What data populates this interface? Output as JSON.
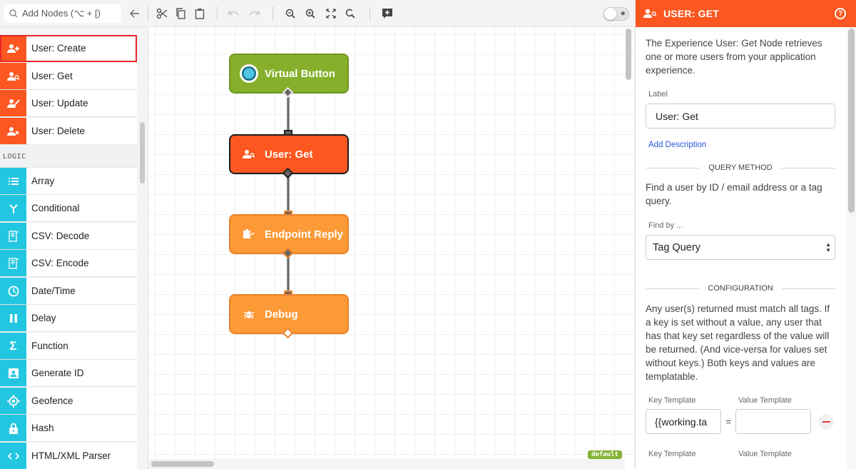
{
  "toolbar": {
    "search_placeholder": "Add Nodes (⌥ + [)",
    "icons": [
      "search-icon",
      "back-arrow-icon",
      "cut-icon",
      "copy-icon",
      "paste-icon",
      "undo-icon",
      "redo-icon",
      "zoom-out-icon",
      "zoom-in-icon",
      "fit-screen-icon",
      "reset-zoom-icon",
      "add-comment-icon"
    ],
    "debug_toggle": false
  },
  "palette": {
    "items": [
      {
        "label": "User: Create",
        "icon": "user-plus-icon",
        "color": "orange",
        "selected": true
      },
      {
        "label": "User: Get",
        "icon": "user-search-icon",
        "color": "orange"
      },
      {
        "label": "User: Update",
        "icon": "user-edit-icon",
        "color": "orange"
      },
      {
        "label": "User: Delete",
        "icon": "user-delete-icon",
        "color": "orange"
      }
    ],
    "section": "LOGIC",
    "logic_items": [
      {
        "label": "Array",
        "icon": "list-icon"
      },
      {
        "label": "Conditional",
        "icon": "branch-icon"
      },
      {
        "label": "CSV: Decode",
        "icon": "csv-decode-icon"
      },
      {
        "label": "CSV: Encode",
        "icon": "csv-encode-icon"
      },
      {
        "label": "Date/Time",
        "icon": "clock-icon"
      },
      {
        "label": "Delay",
        "icon": "pause-icon"
      },
      {
        "label": "Function",
        "icon": "sigma-icon"
      },
      {
        "label": "Generate ID",
        "icon": "id-card-icon"
      },
      {
        "label": "Geofence",
        "icon": "target-icon"
      },
      {
        "label": "Hash",
        "icon": "lock-icon"
      },
      {
        "label": "HTML/XML Parser",
        "icon": "code-icon"
      }
    ]
  },
  "canvas": {
    "nodes": [
      {
        "label": "Virtual Button",
        "icon": "virtual-button-icon"
      },
      {
        "label": "User: Get",
        "icon": "user-search-icon",
        "selected": true
      },
      {
        "label": "Endpoint Reply",
        "icon": "endpoint-reply-icon"
      },
      {
        "label": "Debug",
        "icon": "bug-icon"
      }
    ],
    "badge": "default"
  },
  "panel": {
    "title": "USER: GET",
    "help_label": "?",
    "description": "The Experience User: Get Node retrieves one or more users from your application experience.",
    "label_field_label": "Label",
    "label_value": "User: Get",
    "add_description": "Add Description",
    "query_method_heading": "QUERY METHOD",
    "query_method_text": "Find a user by ID / email address or a tag query.",
    "find_by_label": "Find by ...",
    "find_by_value": "Tag Query",
    "configuration_heading": "CONFIGURATION",
    "configuration_text": "Any user(s) returned must match all tags. If a key is set without a value, any user that has that key set regardless of the value will be returned. (And vice-versa for values set without keys.) Both keys and values are templatable.",
    "key_template_label": "Key Template",
    "value_template_label": "Value Template",
    "tags": [
      {
        "key": "{{working.ta",
        "value": ""
      }
    ],
    "equals": "="
  },
  "colors": {
    "orange": "#fc5720",
    "cyan": "#23c6e0",
    "green": "#86b02c",
    "amber": "#fd9a38",
    "link": "#2456d8"
  }
}
